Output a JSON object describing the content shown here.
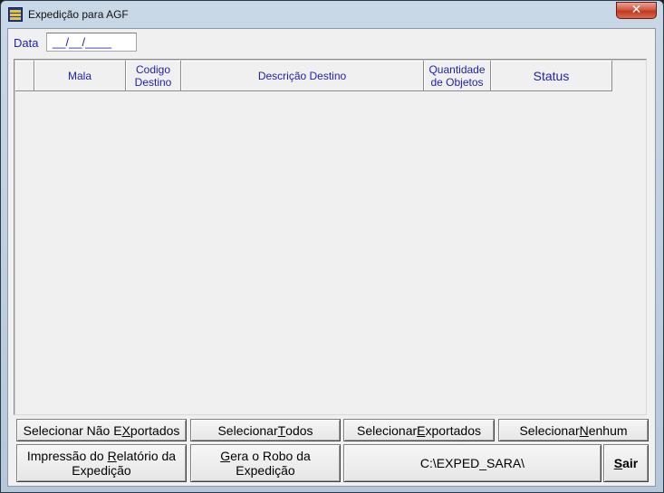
{
  "window": {
    "title": "Expedição para AGF",
    "close_glyph": "✕",
    "icon": "app-icon"
  },
  "date": {
    "label": "Data",
    "value": "__/__/____"
  },
  "grid": {
    "columns": [
      {
        "key": "select",
        "label": ""
      },
      {
        "key": "mala",
        "label": "Mala"
      },
      {
        "key": "codigo",
        "label": "Codigo Destino"
      },
      {
        "key": "descricao",
        "label": "Descrição Destino"
      },
      {
        "key": "quantidade",
        "label": "Quantidade de Objetos"
      },
      {
        "key": "status",
        "label": "Status"
      }
    ],
    "rows": []
  },
  "buttons": {
    "sel_nao_exportados": {
      "pre": "Selecionar Não E",
      "acc": "X",
      "post": "portados"
    },
    "sel_todos": {
      "pre": "Selecionar ",
      "acc": "T",
      "post": "odos"
    },
    "sel_exportados": {
      "pre": "Selecionar ",
      "acc": "E",
      "post": "xportados"
    },
    "sel_nenhum": {
      "pre": "Selecionar ",
      "acc": "N",
      "post": "enhum"
    },
    "impressao": {
      "line1_pre": "Impressão do ",
      "line1_acc": "R",
      "line1_post": "elatório da",
      "line2": "Expedição"
    },
    "gera_robo": {
      "line1_acc": "G",
      "line1_post": "era o Robo da",
      "line2": "Expedição"
    },
    "path": {
      "label": "C:\\EXPED_SARA\\"
    },
    "sair": {
      "acc": "S",
      "post": "air"
    }
  }
}
